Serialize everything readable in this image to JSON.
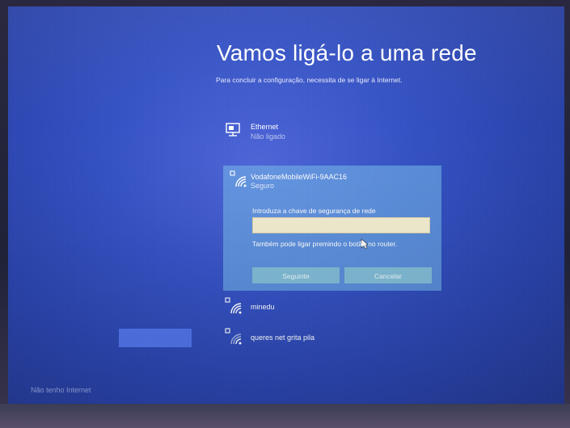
{
  "setup": {
    "title": "Vamos ligá-lo a uma rede",
    "subtitle": "Para concluir a configuração, necessita de se ligar à Internet."
  },
  "networks": [
    {
      "name": "Ethernet",
      "status": "Não ligado",
      "icon": "ethernet-icon"
    },
    {
      "name": "VodafoneMobileWiFi-9AAC16",
      "status": "Seguro",
      "icon": "wifi-secured-icon",
      "selected": true
    },
    {
      "name": "minedu",
      "icon": "wifi-secured-icon"
    },
    {
      "name": "queres net grita pila",
      "icon": "wifi-secured-icon"
    }
  ],
  "connect_panel": {
    "key_label": "Introduza a chave de segurança de rede",
    "key_value": "",
    "router_text": "Também pode ligar premindo o botão no router.",
    "next_label": "Seguinte",
    "cancel_label": "Cancelar"
  },
  "footer": {
    "no_internet_label": "Não tenho Internet"
  },
  "colors": {
    "background": "#3552c4",
    "selected_panel": "#78bee8",
    "input_bg": "#f2ecd0",
    "button_bg": "#8cc8d2"
  }
}
